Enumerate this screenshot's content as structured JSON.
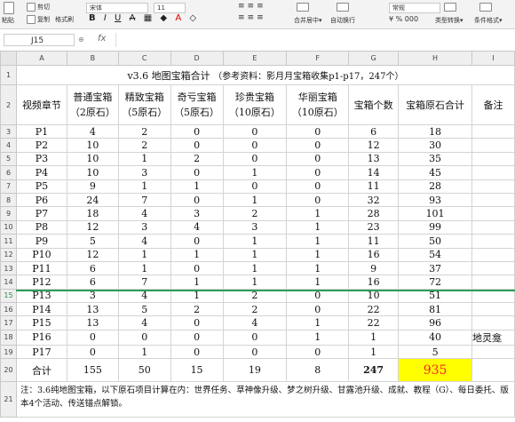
{
  "ribbon": {
    "paste_label": "粘贴",
    "cut_label": "剪切",
    "copy_label": "复制",
    "format_painter_label": "格式刷",
    "font_name": "宋体",
    "font_size": "11",
    "merge_center_label": "合并居中",
    "wrap_text_label": "自动换行",
    "number_format": "常规",
    "type_convert_label": "类型转换",
    "conditional_format_label": "条件格式",
    "bold": "B",
    "italic": "I",
    "underline": "U",
    "strike": "A",
    "percent": "%",
    "thousands": "000"
  },
  "formula_bar": {
    "cell_ref": "J15",
    "fx": "fx",
    "value": ""
  },
  "columns": [
    "A",
    "B",
    "C",
    "D",
    "E",
    "F",
    "G",
    "H",
    "I"
  ],
  "sheet": {
    "title": "v3.6 地图宝箱合计",
    "title_note": "（参考资料：影月月宝箱收集p1-p17，247个）",
    "headers": [
      "视频章节",
      "普通宝箱\n（2原石）",
      "精致宝箱\n（5原石）",
      "奇亏宝箱\n（5原石）",
      "珍贵宝箱\n（10原石）",
      "华丽宝箱\n（10原石）",
      "宝箱个数",
      "宝箱原石合计",
      "备注"
    ],
    "rows": [
      [
        "P1",
        "4",
        "2",
        "0",
        "0",
        "0",
        "6",
        "18",
        ""
      ],
      [
        "P2",
        "10",
        "2",
        "0",
        "0",
        "0",
        "12",
        "30",
        ""
      ],
      [
        "P3",
        "10",
        "1",
        "2",
        "0",
        "0",
        "13",
        "35",
        ""
      ],
      [
        "P4",
        "10",
        "3",
        "0",
        "1",
        "0",
        "14",
        "45",
        ""
      ],
      [
        "P5",
        "9",
        "1",
        "1",
        "0",
        "0",
        "11",
        "28",
        ""
      ],
      [
        "P6",
        "24",
        "7",
        "0",
        "1",
        "0",
        "32",
        "93",
        ""
      ],
      [
        "P7",
        "18",
        "4",
        "3",
        "2",
        "1",
        "28",
        "101",
        ""
      ],
      [
        "P8",
        "12",
        "3",
        "4",
        "3",
        "1",
        "23",
        "99",
        ""
      ],
      [
        "P9",
        "5",
        "4",
        "0",
        "1",
        "1",
        "11",
        "50",
        ""
      ],
      [
        "P10",
        "12",
        "1",
        "1",
        "1",
        "1",
        "16",
        "54",
        ""
      ],
      [
        "P11",
        "6",
        "1",
        "0",
        "1",
        "1",
        "9",
        "37",
        ""
      ],
      [
        "P12",
        "6",
        "7",
        "1",
        "1",
        "1",
        "16",
        "72",
        ""
      ],
      [
        "P13",
        "3",
        "4",
        "1",
        "2",
        "0",
        "10",
        "51",
        ""
      ],
      [
        "P14",
        "13",
        "5",
        "2",
        "2",
        "0",
        "22",
        "81",
        ""
      ],
      [
        "P15",
        "13",
        "4",
        "0",
        "4",
        "1",
        "22",
        "96",
        ""
      ],
      [
        "P16",
        "0",
        "0",
        "0",
        "0",
        "1",
        "1",
        "40",
        "地灵龛"
      ],
      [
        "P17",
        "0",
        "1",
        "0",
        "0",
        "0",
        "1",
        "5",
        ""
      ]
    ],
    "total": [
      "合计",
      "155",
      "50",
      "15",
      "19",
      "8",
      "247",
      "935",
      ""
    ],
    "note": "注：3.6纯地图宝箱，以下原石项目计算在内：世界任务、草神像升级、梦之树升级、甘露池升级、成就、教程（G）、每日委托、版本4个活动、传送锚点解锁。"
  },
  "row_numbers": [
    "1",
    "2",
    "3",
    "4",
    "5",
    "6",
    "7",
    "8",
    "9",
    "10",
    "11",
    "12",
    "13",
    "14",
    "15",
    "16",
    "17",
    "18",
    "19",
    "20",
    "21"
  ]
}
